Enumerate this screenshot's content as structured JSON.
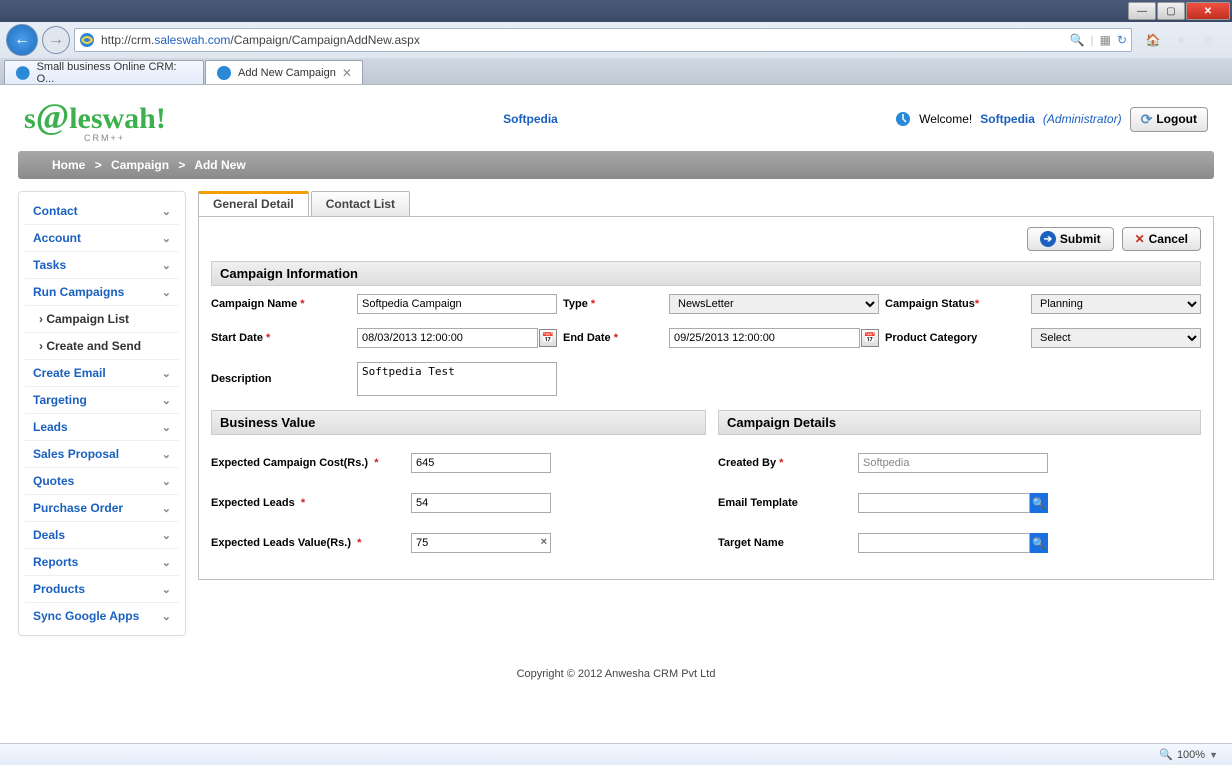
{
  "browser": {
    "url_prefix": "http://crm.",
    "url_domain": "saleswah.com",
    "url_path": "/Campaign/CampaignAddNew.aspx",
    "tab1": "Small business Online CRM: O...",
    "tab2": "Add New Campaign",
    "zoom": "100%"
  },
  "header": {
    "logo_text": "s@leswah!",
    "logo_sub": "CRM++",
    "center_link": "Softpedia",
    "welcome": "Welcome!",
    "user": "Softpedia",
    "role": "(Administrator)",
    "logout": "Logout"
  },
  "breadcrumb": {
    "items": [
      "Home",
      "Campaign",
      "Add New"
    ]
  },
  "sidebar": {
    "items": [
      "Contact",
      "Account",
      "Tasks",
      "Run Campaigns"
    ],
    "sub": [
      "Campaign List",
      "Create and Send"
    ],
    "items2": [
      "Create Email",
      "Targeting",
      "Leads",
      "Sales Proposal",
      "Quotes",
      "Purchase Order",
      "Deals",
      "Reports",
      "Products",
      "Sync Google Apps"
    ]
  },
  "tabs": {
    "t1": "General Detail",
    "t2": "Contact List"
  },
  "buttons": {
    "submit": "Submit",
    "cancel": "Cancel"
  },
  "sections": {
    "info": "Campaign Information",
    "biz": "Business Value",
    "det": "Campaign Details"
  },
  "form": {
    "name_lbl": "Campaign Name",
    "name_val": "Softpedia Campaign",
    "type_lbl": "Type",
    "type_val": "NewsLetter",
    "status_lbl": "Campaign Status",
    "status_val": "Planning",
    "start_lbl": "Start Date",
    "start_val": "08/03/2013 12:00:00",
    "end_lbl": "End Date",
    "end_val": "09/25/2013 12:00:00",
    "pcat_lbl": "Product Category",
    "pcat_val": "Select",
    "desc_lbl": "Description",
    "desc_val": "Softpedia Test",
    "cost_lbl": "Expected Campaign Cost(Rs.)",
    "cost_val": "645",
    "leads_lbl": "Expected Leads",
    "leads_val": "54",
    "lvalue_lbl": "Expected Leads Value(Rs.)",
    "lvalue_val": "75",
    "created_lbl": "Created By",
    "created_val": "Softpedia",
    "email_lbl": "Email Template",
    "email_val": "",
    "target_lbl": "Target Name",
    "target_val": ""
  },
  "footer": "Copyright © 2012 Anwesha CRM Pvt Ltd"
}
